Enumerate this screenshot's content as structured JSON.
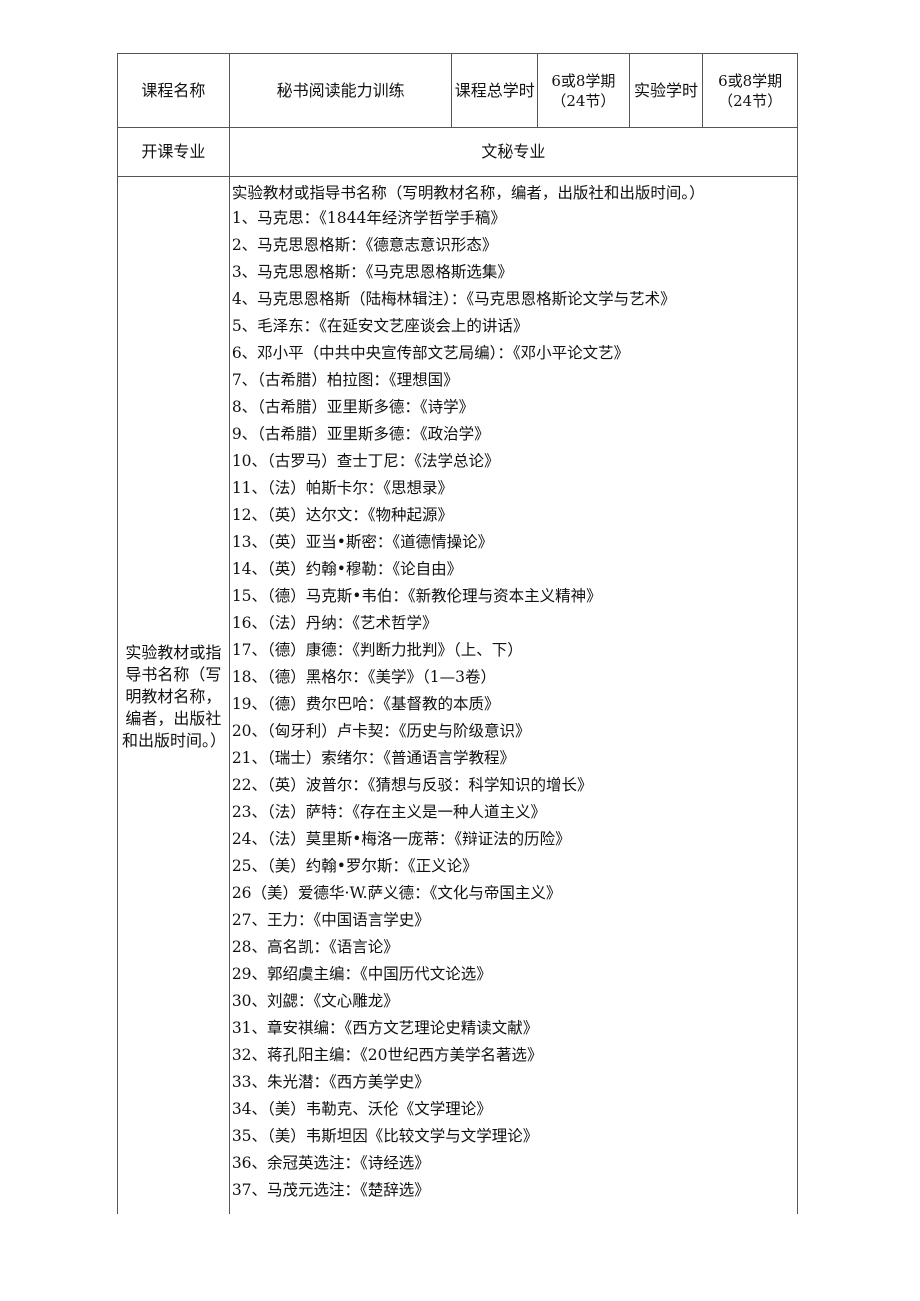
{
  "table": {
    "row1": {
      "course_name_label": "课程名称",
      "course_name_value": "秘书阅读能力训练",
      "total_hours_label": "课程总学时",
      "total_hours_value_line1": "6或8学期",
      "total_hours_value_line2": "（24节）",
      "lab_hours_label": "实验学时",
      "lab_hours_value_line1": "6或8学期",
      "lab_hours_value_line2": "（24节）"
    },
    "row2": {
      "major_label": "开课专业",
      "major_value": "文秘专业"
    },
    "row3": {
      "materials_label": "实验教材或指导书名称（写明教材名称，编者，出版社和出版时间。）",
      "materials_intro": "实验教材或指导书名称（写明教材名称，编者，出版社和出版时间。）",
      "items": [
        "1、马克思：《1844年经济学哲学手稿》",
        "2、马克思恩格斯：《德意志意识形态》",
        "3、马克思恩格斯：《马克思恩格斯选集》",
        "4、马克思恩格斯（陆梅林辑注）：《马克思恩格斯论文学与艺术》",
        "5、毛泽东：《在延安文艺座谈会上的讲话》",
        "6、邓小平（中共中央宣传部文艺局编）：《邓小平论文艺》",
        "7、（古希腊）柏拉图：《理想国》",
        "8、（古希腊）亚里斯多德：《诗学》",
        "9、（古希腊）亚里斯多德：《政治学》",
        "10、（古罗马）查士丁尼：《法学总论》",
        "11、（法）帕斯卡尔：《思想录》",
        "12、（英）达尔文：《物种起源》",
        "13、（英）亚当•斯密：《道德情操论》",
        "14、（英）约翰•穆勒：《论自由》",
        "15、（德）马克斯•韦伯：《新教伦理与资本主义精神》",
        "16、（法）丹纳：《艺术哲学》",
        "17、（德）康德：《判断力批判》（上、下）",
        "18、（德）黑格尔：《美学》（1—3卷）",
        "19、（德）费尔巴哈：《基督教的本质》",
        "20、（匈牙利）卢卡契：《历史与阶级意识》",
        "21、（瑞士）索绪尔：《普通语言学教程》",
        "22、（英）波普尔：《猜想与反驳：科学知识的增长》",
        "23、（法）萨特：《存在主义是一种人道主义》",
        "24、（法）莫里斯•梅洛一庞蒂：《辩证法的历险》",
        "25、（美）约翰•罗尔斯：《正义论》",
        "26（美）爱德华·W.萨义德：《文化与帝国主义》",
        "27、王力：《中国语言学史》",
        "28、高名凯：《语言论》",
        "29、郭绍虞主编：《中国历代文论选》",
        "30、刘勰：《文心雕龙》",
        "31、章安祺编：《西方文艺理论史精读文献》",
        "32、蒋孔阳主编：《20世纪西方美学名著选》",
        "33、朱光潜：《西方美学史》",
        "34、（美）韦勒克、沃伦《文学理论》",
        "35、（美）韦斯坦因《比较文学与文学理论》",
        "36、余冠英选注：《诗经选》",
        "37、马茂元选注：《楚辞选》"
      ]
    }
  }
}
